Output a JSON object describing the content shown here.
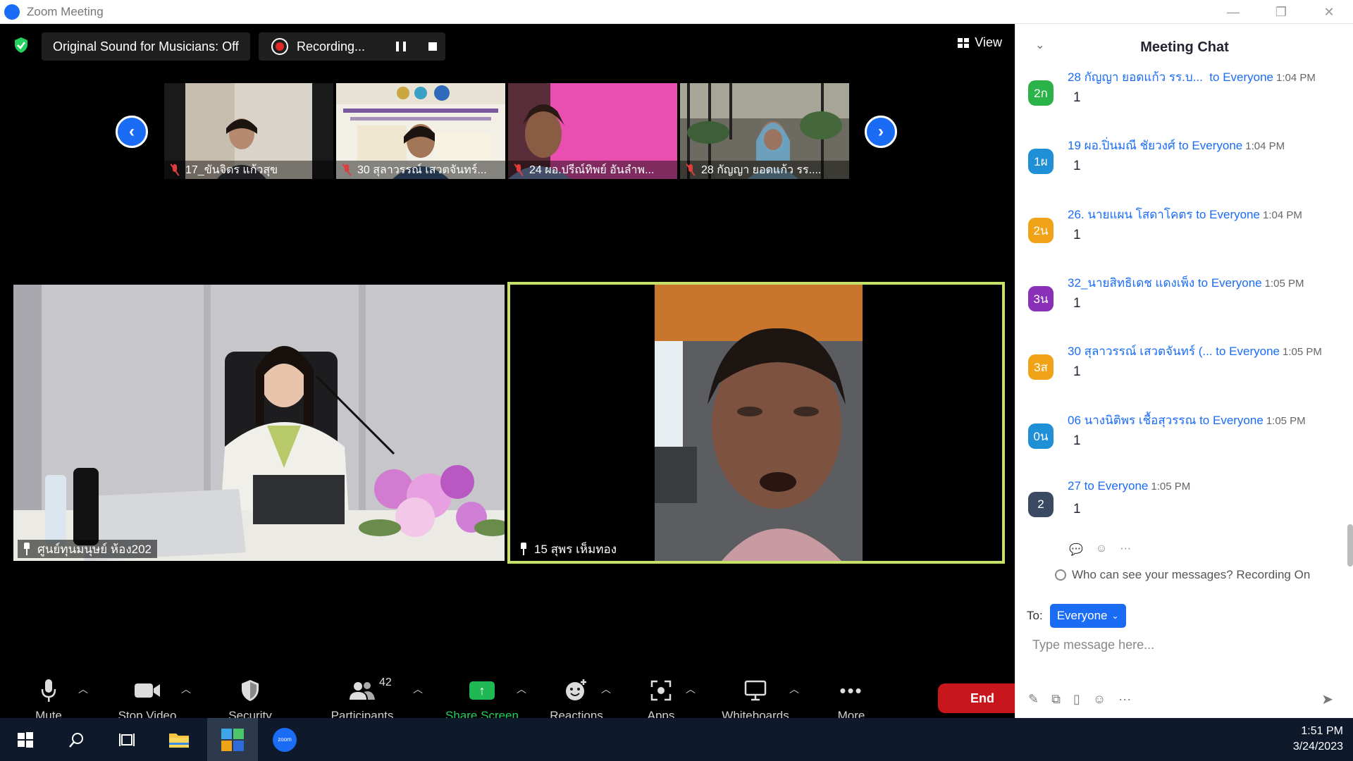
{
  "window": {
    "title": "Zoom Meeting"
  },
  "topbar": {
    "original_sound": "Original Sound for Musicians: Off",
    "recording": "Recording...",
    "view": "View"
  },
  "filmstrip": [
    {
      "name": "17_ขันจิตร แก้วสุข"
    },
    {
      "name": "30 สุลาวรรณ์ เสวตจันทร์..."
    },
    {
      "name": "24 ผอ.ปรีณ์ทิพย์ อันลำพ..."
    },
    {
      "name": "28 กัญญา  ยอดแก้ว รร...."
    }
  ],
  "main_videos": [
    {
      "name": "ศูนย์ทุนมนุษย์ ห้อง202"
    },
    {
      "name": "15 สุพร เห็มทอง"
    }
  ],
  "toolbar": {
    "mute": "Mute",
    "stop_video": "Stop Video",
    "security": "Security",
    "participants": "Participants",
    "participant_count": "42",
    "share_screen": "Share Screen",
    "reactions": "Reactions",
    "apps": "Apps",
    "whiteboards": "Whiteboards",
    "more": "More",
    "end": "End"
  },
  "chat": {
    "title": "Meeting Chat",
    "messages": [
      {
        "avatar": "2ก",
        "color": "#2bb34a",
        "sender": "28 กัญญา  ยอดแก้ว รร.บ...",
        "to": "to Everyone",
        "time": "1:04 PM",
        "body": "1"
      },
      {
        "avatar": "1ผ",
        "color": "#1f8fd6",
        "sender": "19 ผอ.ปิ่นมณี ชัยวงศ์",
        "to": "to Everyone",
        "time": "1:04 PM",
        "body": "1"
      },
      {
        "avatar": "2น",
        "color": "#f0a316",
        "sender": "26. นายแผน  โสดาโคตร",
        "to": "to Everyone",
        "time": "1:04 PM",
        "body": "1"
      },
      {
        "avatar": "3น",
        "color": "#8a2fb8",
        "sender": "32_นายสิทธิเดช  แดงเพ็ง",
        "to": "to Everyone",
        "time": "1:05 PM",
        "body": "1"
      },
      {
        "avatar": "3ส",
        "color": "#f0a316",
        "sender": "30 สุลาวรรณ์ เสวตจันทร์ (...",
        "to": "to Everyone",
        "time": "1:05 PM",
        "body": "1"
      },
      {
        "avatar": "0น",
        "color": "#1f8fd6",
        "sender": "06 นางนิติพร เชื้อสุวรรณ",
        "to": "to Everyone",
        "time": "1:05 PM",
        "body": "1"
      },
      {
        "avatar": "2",
        "color": "#3b4a63",
        "sender": "27",
        "to": "to Everyone",
        "time": "1:05 PM",
        "body": "1"
      }
    ],
    "who_can_see": "Who can see your messages? Recording On",
    "to_label": "To:",
    "recipient": "Everyone",
    "input_placeholder": "Type message here..."
  },
  "taskbar": {
    "time": "1:51 PM",
    "date": "3/24/2023",
    "zoom_icon_label": "zoom"
  }
}
